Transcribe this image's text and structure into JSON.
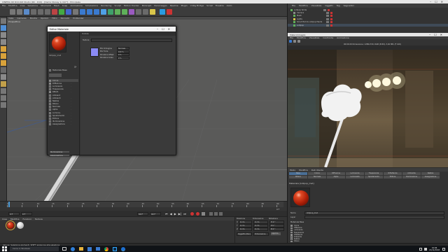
{
  "app": {
    "title": "CINEMA 4D R19.024 Studio (RC - R19) - [Demo Disney 1.c4d *] - Principale",
    "menu": [
      "File",
      "Modifica",
      "Crea",
      "Seleziona",
      "Strumenti",
      "Mesh",
      "Snap",
      "Animazione",
      "Simulazione",
      "Rendering",
      "Sculpt",
      "Motion Tracker",
      "MoGraph",
      "Personaggio",
      "Pipeline",
      "Plugin",
      "V-Ray Bridge",
      "Script",
      "Finestre",
      "Aiuto",
      "Layout:"
    ],
    "layout_value": "Avvio (Utente)"
  },
  "viewport": {
    "tab_label": "Prospettiva",
    "menu": [
      "Vista",
      "Cameras",
      "Mostra",
      "Opzioni",
      "Filtro",
      "Pannello",
      "ProRender"
    ]
  },
  "material_editor": {
    "title": "Editor Materiale",
    "material_name": "lollipop_mat",
    "section_title": "Colore",
    "texture_label": "Texture",
    "color_label": "Colore",
    "properties": [
      {
        "label": "Mix Immagine",
        "value": "Normale"
      },
      {
        "label": "Mix Forza",
        "value": "100 %"
      },
      {
        "label": "Sfocatura Offset",
        "value": "0 %"
      },
      {
        "label": "Sfocatura Scala",
        "value": "0 %"
      }
    ],
    "channels_header": "Materiale Base",
    "channels": [
      "Colore",
      "Diffusione",
      "Luminanza",
      "Trasparenza",
      "Riflett.",
      "Ambient",
      "Ambienti",
      "Nebbia",
      "Rilievo",
      "Normale",
      "Alpha",
      "Luminos.",
      "Spostamento",
      "Editore",
      "Illuminazione",
      "Assegnazione"
    ],
    "channels_dots": [
      "",
      ".",
      ".",
      ".",
      ".",
      "",
      ".",
      ".",
      ".",
      ".",
      ".",
      ".",
      ".",
      ".",
      ".",
      "."
    ],
    "channels_checked": [
      true,
      true,
      false,
      false,
      true,
      false,
      false,
      false,
      false,
      false,
      false,
      false,
      false,
      false,
      false,
      false
    ],
    "active_channel_index": 0,
    "swatch_color": "#8b8bf5",
    "bottom_buttons": [
      "Illuminazione",
      "Assegnazione"
    ]
  },
  "objects": {
    "menu": [
      "File",
      "Modifica",
      "Visualizza",
      "Oggetti",
      "Tag",
      "Segnalibri"
    ],
    "items": [
      "Lollipop Smile",
      "Camera",
      "Mesh",
      "Lights",
      "Smart Part & Lollipop Plants",
      "Lollipop"
    ]
  },
  "render": {
    "title": "Vista Immagini",
    "menu": [
      "File",
      "Modifica",
      "Visualizza",
      "Confronta",
      "Animazione"
    ],
    "status": "00:00:29  Dimensione: 1280x720, RGB (8 Bit), 3,40 MB, (F 100)"
  },
  "timeline": {
    "ticks": [
      "0",
      "5",
      "10",
      "15",
      "20",
      "25",
      "30",
      "35",
      "40",
      "45",
      "50",
      "55",
      "60",
      "65",
      "70",
      "75",
      "80",
      "85",
      "90"
    ],
    "frame_start": "0 F",
    "frame_field": "0 F",
    "frame_end": "90 F",
    "frame_end2": "90 F",
    "current_frame": "0 F"
  },
  "materials_panel": {
    "menu": [
      "Crea",
      "Modifica",
      "Funzioni",
      "Texture"
    ]
  },
  "coords": {
    "headers": [
      "Posizione",
      "Dimensione",
      "Rotazione"
    ],
    "rows": [
      {
        "axis": "X",
        "pos": "0 cm",
        "size": "0 cm",
        "rot": "H 0 °"
      },
      {
        "axis": "Y",
        "pos": "0 cm",
        "size": "0 cm",
        "rot": "P 0 °"
      },
      {
        "axis": "Z",
        "pos": "0 cm",
        "size": "0 cm",
        "rot": "B 0 °"
      }
    ],
    "mode": "Oggetto (Rel.)",
    "size_mode": "Dimensione",
    "apply": "Applica"
  },
  "attributes": {
    "menu": [
      "Modo",
      "Modifica",
      "Dati Utente"
    ],
    "tabs": [
      "Base",
      "Colore",
      "Diffusione",
      "Luminanza",
      "Trasparenza",
      "Riflettanza",
      "Ambiente",
      "Nebbia",
      "Rilievo",
      "Normale",
      "Alpha",
      "Luminosità",
      "Spostamento",
      "Editore",
      "Illuminazione",
      "Assegnazione"
    ],
    "heading": "Materiale [lollipop_mat]",
    "name_label": "Nome",
    "name_value": "lollipop_mat",
    "layer_label": "Layer",
    "channels_header": "Materiale Base",
    "channels": [
      "Colore",
      "Diffusione",
      "Luminanza",
      "Trasparenza",
      "Riflettanza",
      "Ambiente",
      "Nebbia",
      "Rilievo"
    ],
    "channels_checked": [
      true,
      true,
      false,
      false,
      true,
      false,
      false,
      false
    ]
  },
  "statusbar": {
    "text": "Azione: Seleziona elementi. SHIFT aggiunge alla selezione"
  },
  "taskbar": {
    "search_placeholder": "Cerca in Windows",
    "time": "19:06",
    "date": "21/11/2018"
  },
  "colors": {
    "viewport_bg": "#5a5a59",
    "panel_bg": "#333333",
    "accent": "#3a6a9e",
    "taskbar_bg": "#101317",
    "lollipop_red": "#c52a10"
  }
}
